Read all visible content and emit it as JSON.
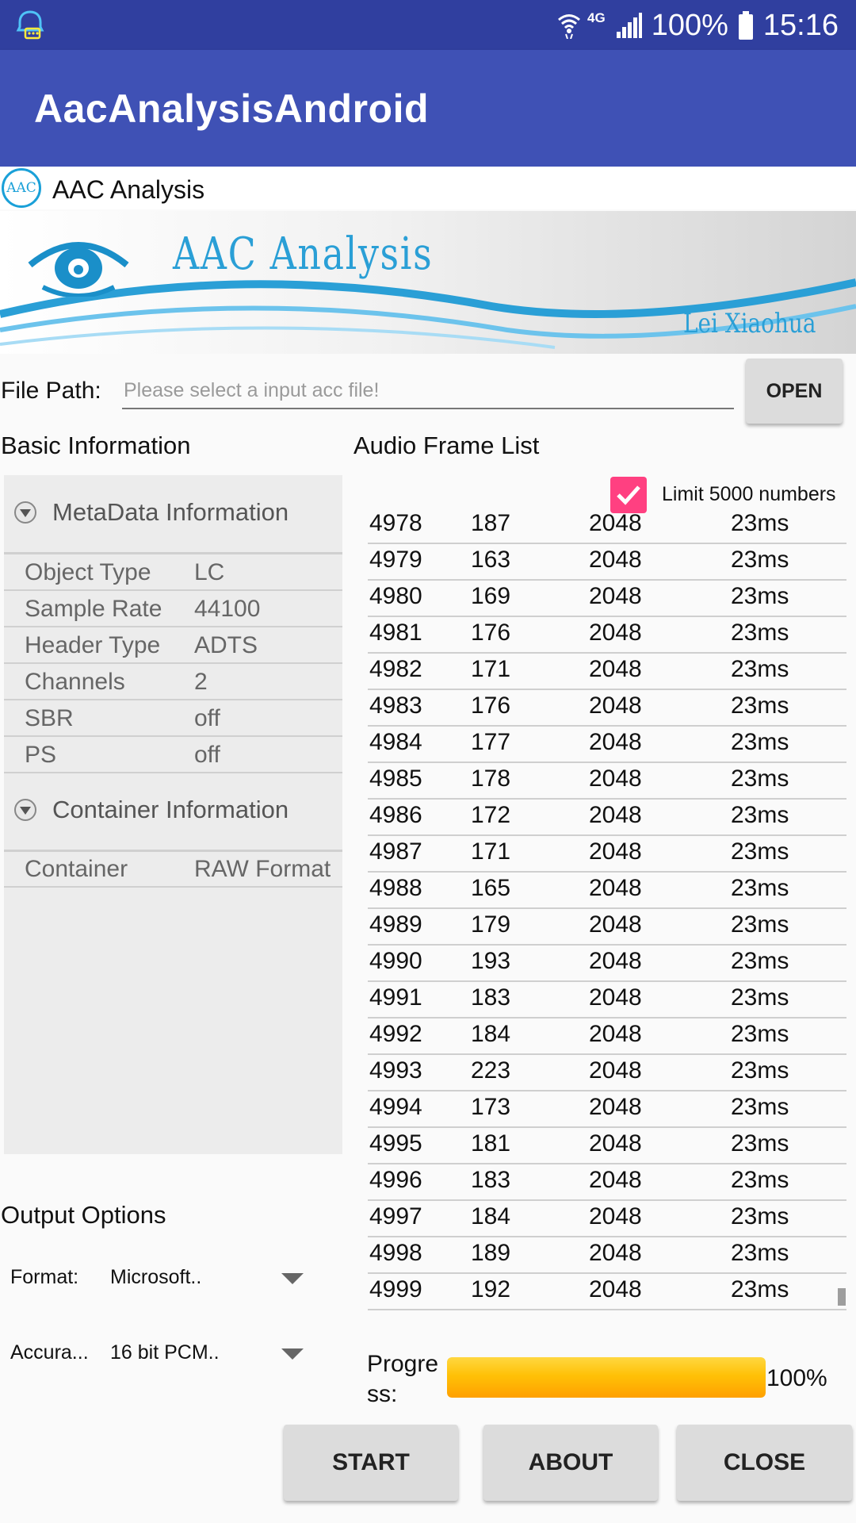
{
  "status_bar": {
    "network_type": "4G",
    "battery": "100%",
    "time": "15:16",
    "icons": [
      "notification-app-icon",
      "wifi-icon",
      "signal-icon",
      "battery-icon"
    ]
  },
  "app_bar": {
    "title": "AacAnalysisAndroid"
  },
  "subtitle": {
    "logo_text": "AAC",
    "text": "AAC Analysis"
  },
  "banner": {
    "title": "AAC Analysis",
    "author": "Lei Xiaohua",
    "icon": "eye-icon"
  },
  "file": {
    "label": "File Path:",
    "placeholder": "Please select a input acc file!",
    "value": "",
    "open_label": "OPEN"
  },
  "basic_info": {
    "title": "Basic Information",
    "metadata": {
      "header": "MetaData Information",
      "rows": [
        {
          "key": "Object Type",
          "value": "LC"
        },
        {
          "key": "Sample Rate",
          "value": "44100"
        },
        {
          "key": "Header Type",
          "value": "ADTS"
        },
        {
          "key": "Channels",
          "value": "2"
        },
        {
          "key": "SBR",
          "value": "off"
        },
        {
          "key": "PS",
          "value": "off"
        }
      ]
    },
    "container": {
      "header": "Container Information",
      "rows": [
        {
          "key": "Container",
          "value": "RAW Format"
        }
      ]
    }
  },
  "frame_list": {
    "title": "Audio Frame List",
    "limit_label": "Limit 5000 numbers",
    "limit_checked": true,
    "rows": [
      [
        "4978",
        "187",
        "2048",
        "23ms"
      ],
      [
        "4979",
        "163",
        "2048",
        "23ms"
      ],
      [
        "4980",
        "169",
        "2048",
        "23ms"
      ],
      [
        "4981",
        "176",
        "2048",
        "23ms"
      ],
      [
        "4982",
        "171",
        "2048",
        "23ms"
      ],
      [
        "4983",
        "176",
        "2048",
        "23ms"
      ],
      [
        "4984",
        "177",
        "2048",
        "23ms"
      ],
      [
        "4985",
        "178",
        "2048",
        "23ms"
      ],
      [
        "4986",
        "172",
        "2048",
        "23ms"
      ],
      [
        "4987",
        "171",
        "2048",
        "23ms"
      ],
      [
        "4988",
        "165",
        "2048",
        "23ms"
      ],
      [
        "4989",
        "179",
        "2048",
        "23ms"
      ],
      [
        "4990",
        "193",
        "2048",
        "23ms"
      ],
      [
        "4991",
        "183",
        "2048",
        "23ms"
      ],
      [
        "4992",
        "184",
        "2048",
        "23ms"
      ],
      [
        "4993",
        "223",
        "2048",
        "23ms"
      ],
      [
        "4994",
        "173",
        "2048",
        "23ms"
      ],
      [
        "4995",
        "181",
        "2048",
        "23ms"
      ],
      [
        "4996",
        "183",
        "2048",
        "23ms"
      ],
      [
        "4997",
        "184",
        "2048",
        "23ms"
      ],
      [
        "4998",
        "189",
        "2048",
        "23ms"
      ],
      [
        "4999",
        "192",
        "2048",
        "23ms"
      ]
    ]
  },
  "output": {
    "title": "Output Options",
    "format_label": "Format:",
    "format_value": "Microsoft..",
    "accuracy_label": "Accura...",
    "accuracy_value": "16 bit PCM.."
  },
  "progress": {
    "label": "Progre ss:",
    "value_text": "100%",
    "fraction": 1.0
  },
  "buttons": {
    "start": "START",
    "about": "ABOUT",
    "close": "CLOSE"
  },
  "colors": {
    "status_bar": "#303f9f",
    "app_bar": "#3f51b5",
    "accent": "#ff4081",
    "progress": "#ffc107",
    "banner_text": "#2a9fd6"
  }
}
